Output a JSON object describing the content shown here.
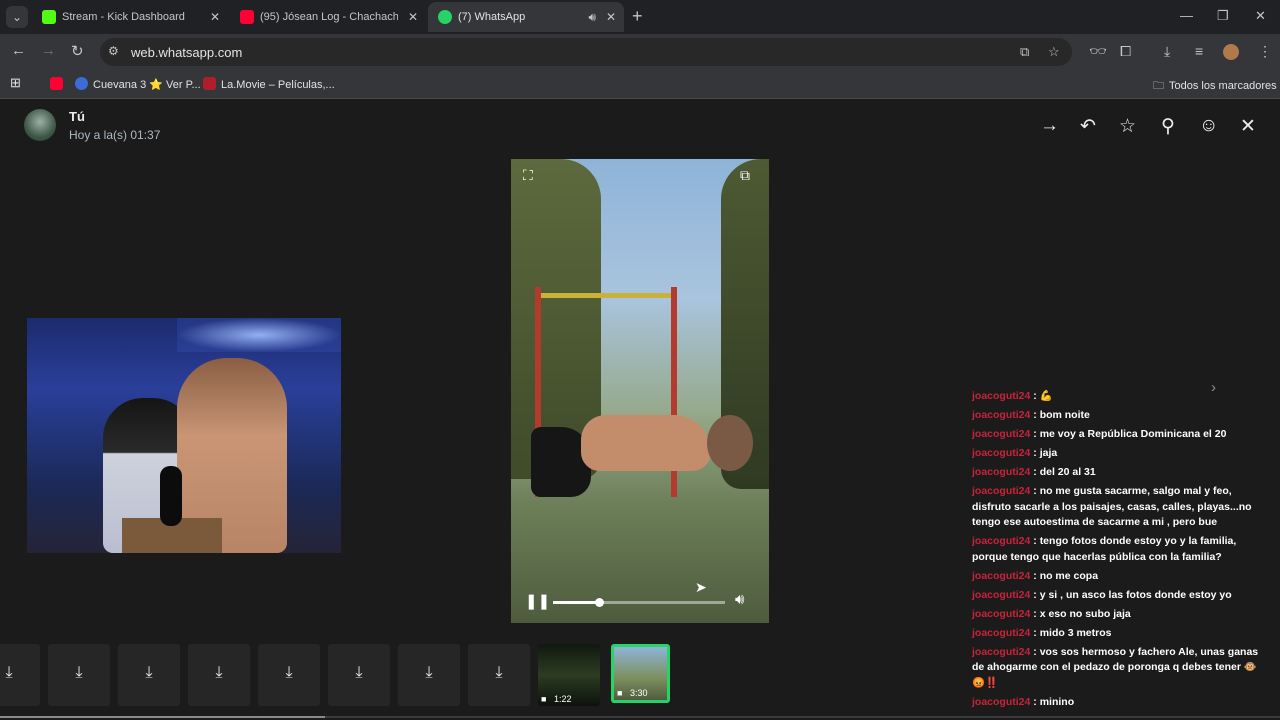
{
  "browser": {
    "tabs": [
      {
        "title": "Stream - Kick Dashboard",
        "favicon": "kick-icon",
        "color": "#53fc18"
      },
      {
        "title": "(95) Jósean Log - Chachachá (Le",
        "favicon": "youtube-icon",
        "color": "#ff0033"
      },
      {
        "title": "(7) WhatsApp",
        "favicon": "whatsapp-icon",
        "color": "#25d366"
      }
    ],
    "new_tab": "+",
    "url": "web.whatsapp.com",
    "bookmarks": [
      {
        "label": "",
        "icon": "youtube-icon",
        "color": "#ff0033"
      },
      {
        "label": "Cuevana 3 ⭐ Ver P...",
        "icon": "cuevana-icon",
        "color": "#3d6bd8"
      },
      {
        "label": "La.Movie – Películas,...",
        "icon": "lamovie-icon",
        "color": "#b01e2b"
      }
    ],
    "all_bookmarks": "Todos los marcadores"
  },
  "viewer": {
    "sender": "Tú",
    "timestamp": "Hoy a la(s) 01:37",
    "actions": [
      "forward-icon",
      "reply-icon",
      "star-icon",
      "pin-icon",
      "emoji-icon",
      "close-icon"
    ],
    "video": {
      "playing": true,
      "progress": 0.27
    }
  },
  "thumbnails": {
    "download_count": 8,
    "videos": [
      {
        "duration": "1:22",
        "selected": false
      },
      {
        "duration": "3:30",
        "selected": true
      }
    ]
  },
  "chat": {
    "user_color": "#c8233b",
    "messages": [
      {
        "user": "joacoguti24",
        "text": " : 💪"
      },
      {
        "user": "joacoguti24",
        "text": " : bom noite"
      },
      {
        "user": "joacoguti24",
        "text": " : me voy a República Dominicana el 20"
      },
      {
        "user": "joacoguti24",
        "text": " : jaja"
      },
      {
        "user": "joacoguti24",
        "text": " : del 20 al 31"
      },
      {
        "user": "joacoguti24",
        "text": " : no me gusta sacarme, salgo mal y feo, disfruto sacarle a los paisajes, casas, calles, playas...no tengo ese autoestima de sacarme a mi , pero bue"
      },
      {
        "user": "joacoguti24",
        "text": " : tengo fotos donde estoy yo y la familia, porque tengo que hacerlas pública con la familia?"
      },
      {
        "user": "joacoguti24",
        "text": " : no me copa"
      },
      {
        "user": "joacoguti24",
        "text": " : y si , un asco las fotos donde estoy yo"
      },
      {
        "user": "joacoguti24",
        "text": " : x eso no subo jaja"
      },
      {
        "user": "joacoguti24",
        "text": " : mido 3 metros"
      },
      {
        "user": "joacoguti24",
        "text": " : vos sos hermoso y fachero Ale, unas ganas de ahogarme con el pedazo de poronga q debes tener 🐵😡‼️"
      },
      {
        "user": "joacoguti24",
        "text": " : minino"
      }
    ]
  }
}
